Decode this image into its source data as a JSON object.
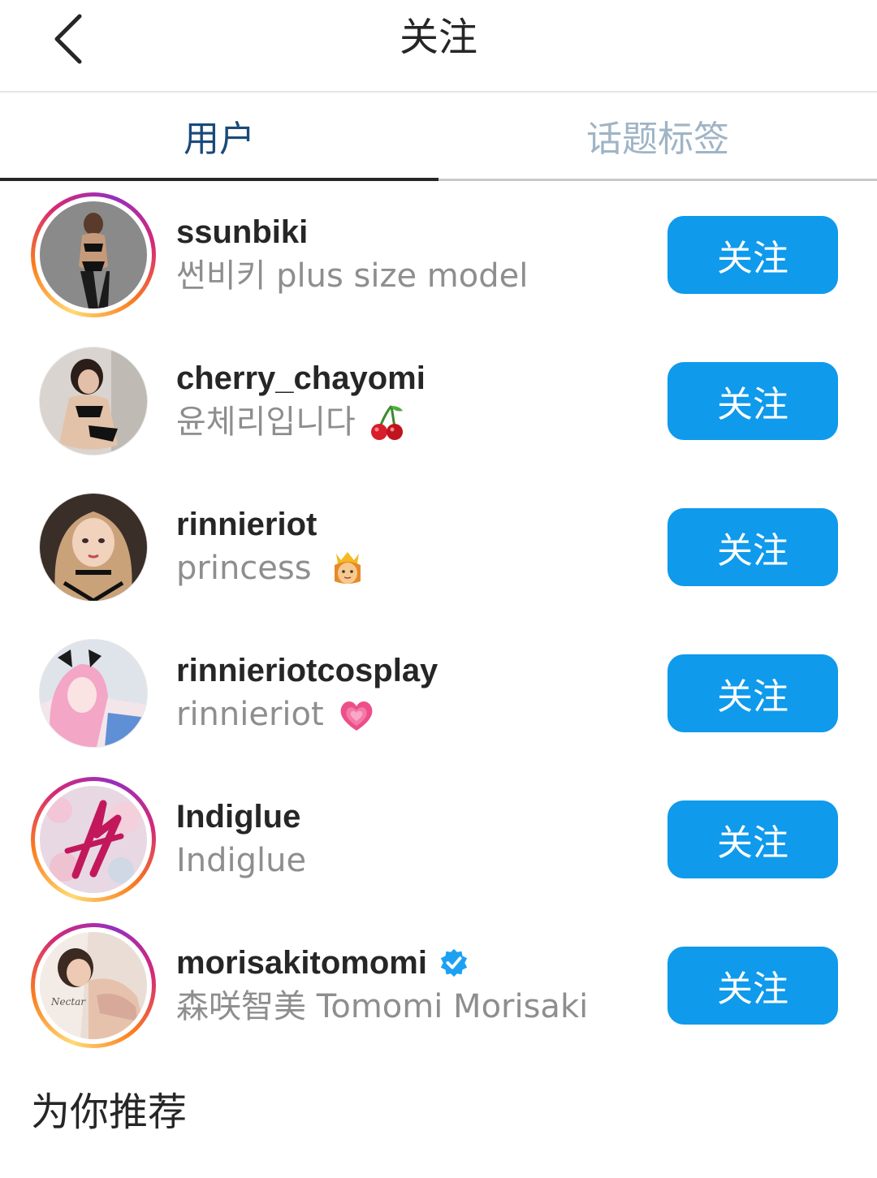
{
  "header": {
    "title": "关注",
    "back_icon": "chevron-left-icon"
  },
  "tabs": [
    {
      "label": "用户",
      "active": true
    },
    {
      "label": "话题标签",
      "active": false
    }
  ],
  "colors": {
    "accent": "#0f9aec",
    "active_tab": "#1a4a7a",
    "inactive_tab": "#9fb4c6",
    "secondary_text": "#8e8e8e"
  },
  "users": [
    {
      "username": "ssunbiki",
      "full_name": "썬비키 plus size model",
      "emoji": "",
      "verified": false,
      "story_ring": true,
      "button": "关注"
    },
    {
      "username": "cherry_chayomi",
      "full_name": "윤체리입니다",
      "emoji": "cherry-emoji",
      "verified": false,
      "story_ring": false,
      "button": "关注"
    },
    {
      "username": "rinnieriot",
      "full_name": "princess",
      "emoji": "princess-emoji",
      "verified": false,
      "story_ring": false,
      "button": "关注"
    },
    {
      "username": "rinnieriotcosplay",
      "full_name": "rinnieriot",
      "emoji": "growing-heart-emoji",
      "verified": false,
      "story_ring": false,
      "button": "关注"
    },
    {
      "username": "Indiglue",
      "full_name": "Indiglue",
      "emoji": "",
      "verified": false,
      "story_ring": true,
      "button": "关注"
    },
    {
      "username": "morisakitomomi",
      "full_name": "森咲智美 Tomomi Morisaki",
      "emoji": "",
      "verified": true,
      "story_ring": true,
      "button": "关注"
    }
  ],
  "section": {
    "title": "为你推荐"
  }
}
